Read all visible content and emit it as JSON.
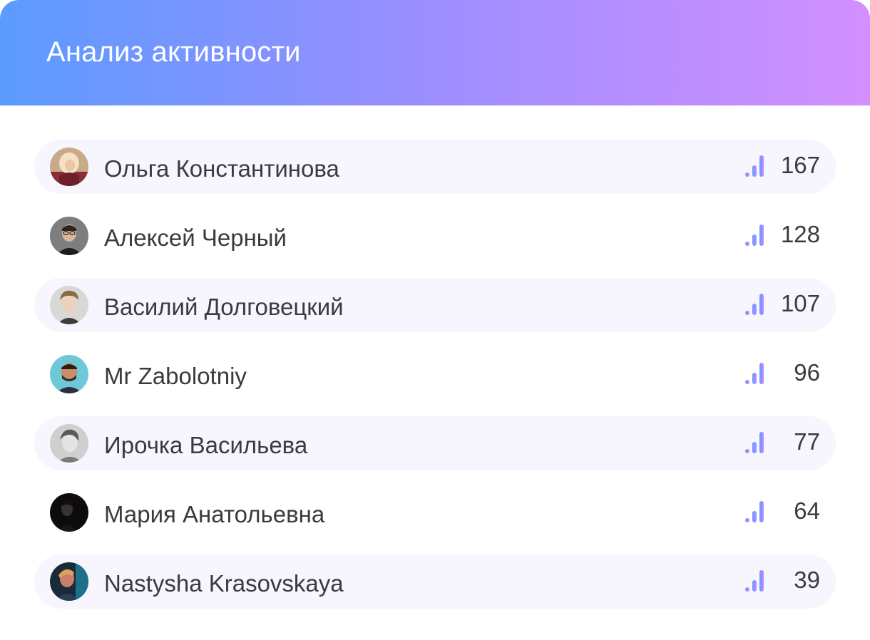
{
  "header": {
    "title": "Анализ активности"
  },
  "colors": {
    "gradient_start": "#5b9bff",
    "gradient_end": "#d38fff",
    "row_highlight": "#f7f5fd",
    "text": "#3a3a3f"
  },
  "users": [
    {
      "name": "Ольга Константинова",
      "score": "167",
      "avatar_icon": "avatar-woman-blonde-icon"
    },
    {
      "name": "Алексей Черный",
      "score": "128",
      "avatar_icon": "avatar-man-glasses-icon"
    },
    {
      "name": "Василий Долговецкий",
      "score": "107",
      "avatar_icon": "avatar-man-curly-icon"
    },
    {
      "name": "Mr Zabolotniy",
      "score": "96",
      "avatar_icon": "avatar-man-beard-icon"
    },
    {
      "name": "Ирочка Васильева",
      "score": "77",
      "avatar_icon": "avatar-woman-bw-icon"
    },
    {
      "name": "Мария Анатольевна",
      "score": "64",
      "avatar_icon": "avatar-woman-dark-icon"
    },
    {
      "name": "Nastysha Krasovskaya",
      "score": "39",
      "avatar_icon": "avatar-woman-neon-icon"
    }
  ]
}
